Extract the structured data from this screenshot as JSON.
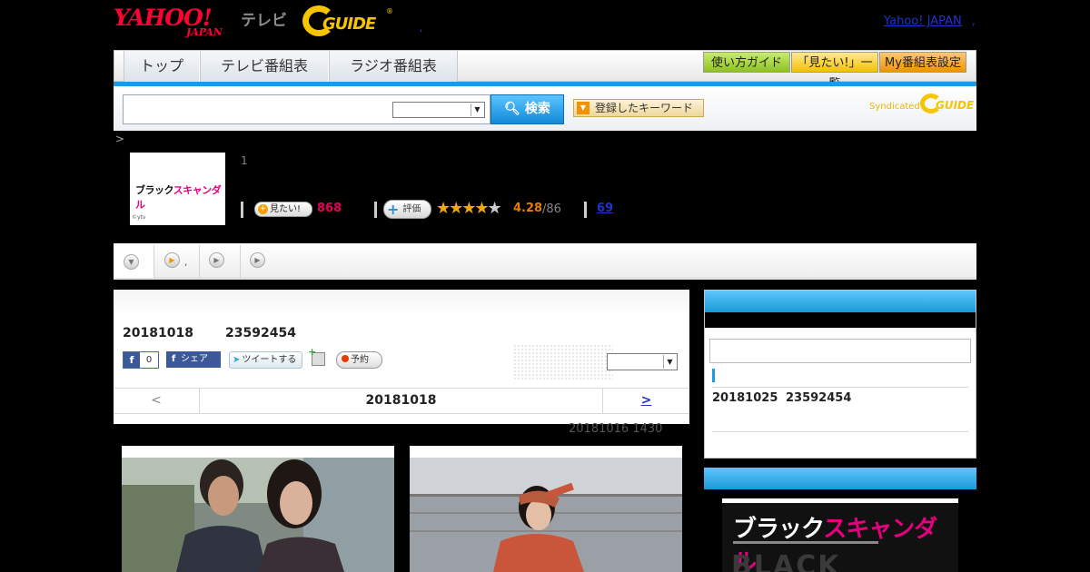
{
  "header": {
    "yahoo_logo": "YAHOO!",
    "yahoo_sub": "JAPAN",
    "tv_label": "テレビ",
    "gguide_logo": "GUIDE",
    "gguide_reg": "®",
    "header_dot": ",",
    "yahoo_japan_link": "Yahoo! JAPAN",
    "yahoo_japan_dot": ","
  },
  "nav": {
    "tabs": [
      {
        "label": "トップ"
      },
      {
        "label": "テレビ番組表"
      },
      {
        "label": "ラジオ番組表"
      }
    ],
    "buttons": [
      {
        "label": "使い方ガイド"
      },
      {
        "label": "「見たい!」一覧"
      },
      {
        "label": "My番組表設定"
      }
    ]
  },
  "search": {
    "input_value": "",
    "select_value": "",
    "search_label": "検索",
    "keyword_label": "登録したキーワード",
    "syndicated_label": "Syndicated",
    "syndicated_logo": "GUIDE"
  },
  "breadcrumb": ">",
  "program": {
    "thumb_title_a": "ブラック",
    "thumb_title_b": "スキャンダル",
    "thumb_credit": "©ytv",
    "count": "1",
    "mitai_label": "見たい!",
    "mitai_count": "868",
    "eval_label": "評価",
    "stars_filled": "★★★★",
    "stars_empty": "★",
    "rating": "4.28",
    "rating_count": "/86",
    "review_count": "69"
  },
  "tabs_strip": {
    "tab2_dot": ","
  },
  "episode": {
    "date": "20181018",
    "id": "23592454",
    "fb_like_count": "0",
    "fb_share_label": "シェア",
    "tweet_label": "ツイートする",
    "reserve_label": "予約",
    "select_value": "",
    "pager_prev": "<",
    "pager_current": "20181018",
    "pager_next": ">",
    "update_note": "20181016  1430"
  },
  "sidebar": {
    "input_value": "",
    "date": "20181025",
    "id": "23592454",
    "poster_title_a": "ブラック",
    "poster_title_b": "スキャンダル",
    "poster_big": "BLACK"
  },
  "colors": {
    "accent_blue": "#1d9be2",
    "yahoo_red": "#ff0033",
    "gguide_yellow": "#f7c500",
    "mitai_pink": "#e6005a",
    "rating_orange": "#e67d00",
    "link_blue": "#2233cc"
  },
  "icons": {
    "search": "magnifier-icon",
    "dropdown": "chevron-down-icon",
    "play": "play-circle-icon",
    "calendar": "calendar-add-icon",
    "record": "record-dot-icon"
  }
}
